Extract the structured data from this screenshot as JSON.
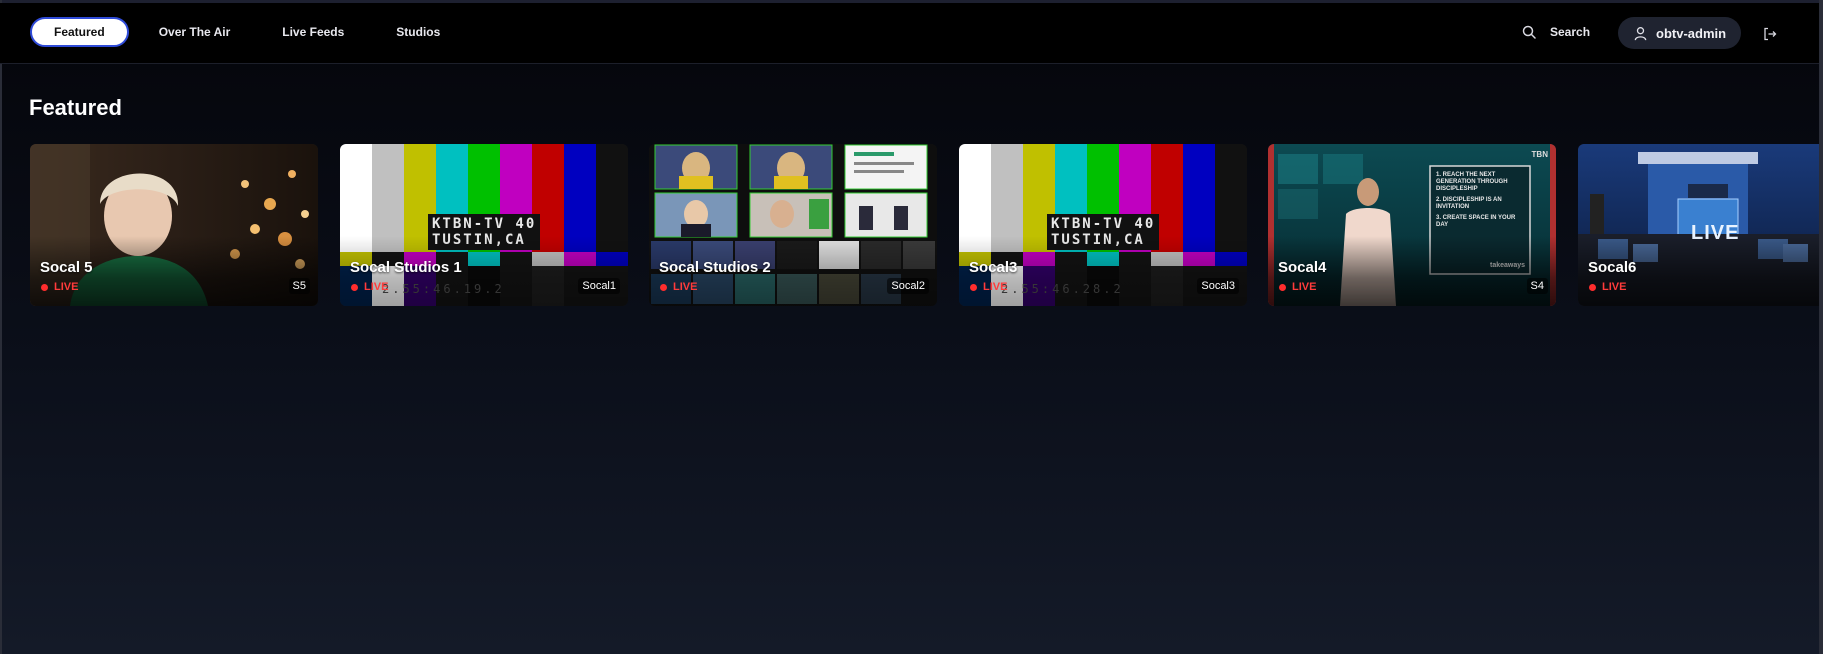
{
  "nav": {
    "tabs": [
      {
        "label": "Featured",
        "active": true
      },
      {
        "label": "Over The Air",
        "active": false
      },
      {
        "label": "Live Feeds",
        "active": false
      },
      {
        "label": "Studios",
        "active": false
      }
    ],
    "search_label": "Search",
    "user_label": "obtv-admin",
    "icons": {
      "search": "search-icon",
      "user": "user-icon",
      "logout": "logout-icon"
    }
  },
  "section": {
    "title": "Featured"
  },
  "cards": [
    {
      "title": "Socal 5",
      "status": "LIVE",
      "code": "S5"
    },
    {
      "title": "Socal Studios 1",
      "status": "LIVE",
      "code": "Socal1",
      "slate": [
        "KTBN-TV 40",
        "TUSTIN,CA"
      ],
      "timecode": "2.55:46.19.2"
    },
    {
      "title": "Socal Studios 2",
      "status": "LIVE",
      "code": "Socal2"
    },
    {
      "title": "Socal3",
      "status": "LIVE",
      "code": "Socal3",
      "slate": [
        "KTBN-TV 40",
        "TUSTIN,CA"
      ],
      "timecode": "2.55:46.28.2"
    },
    {
      "title": "Socal4",
      "status": "LIVE",
      "code": "S4",
      "board": [
        "1. REACH THE NEXT GENERATION THROUGH DISCIPLESHIP",
        "2. DISCIPLESHIP IS AN INVITATION",
        "3. CREATE SPACE IN YOUR DAY"
      ],
      "board_footer": "takeaways",
      "network": "TBN"
    },
    {
      "title": "Socal6",
      "status": "LIVE",
      "code": "",
      "screen_text": "LIVE"
    }
  ],
  "colors": {
    "accent": "#2f4bd8",
    "live": "#ff3b3b",
    "background": "#0b0f1a"
  }
}
